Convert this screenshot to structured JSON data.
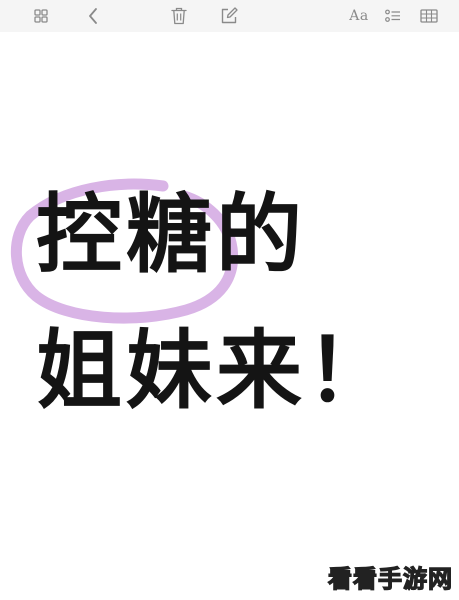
{
  "toolbar": {
    "icons": [
      "grid-view-icon",
      "back-chevron-icon",
      "trash-icon",
      "compose-icon",
      "text-format-icon",
      "checklist-icon",
      "table-icon"
    ],
    "format_label": "Aa"
  },
  "note": {
    "line1": "控糖的",
    "line2": "姐妹来！",
    "highlight_color": "#d9b4e6"
  },
  "watermark": {
    "text": "看看手游网"
  },
  "colors": {
    "toolbar_bg": "#f5f5f5",
    "icon": "#8a8a8a",
    "text": "#141414"
  }
}
